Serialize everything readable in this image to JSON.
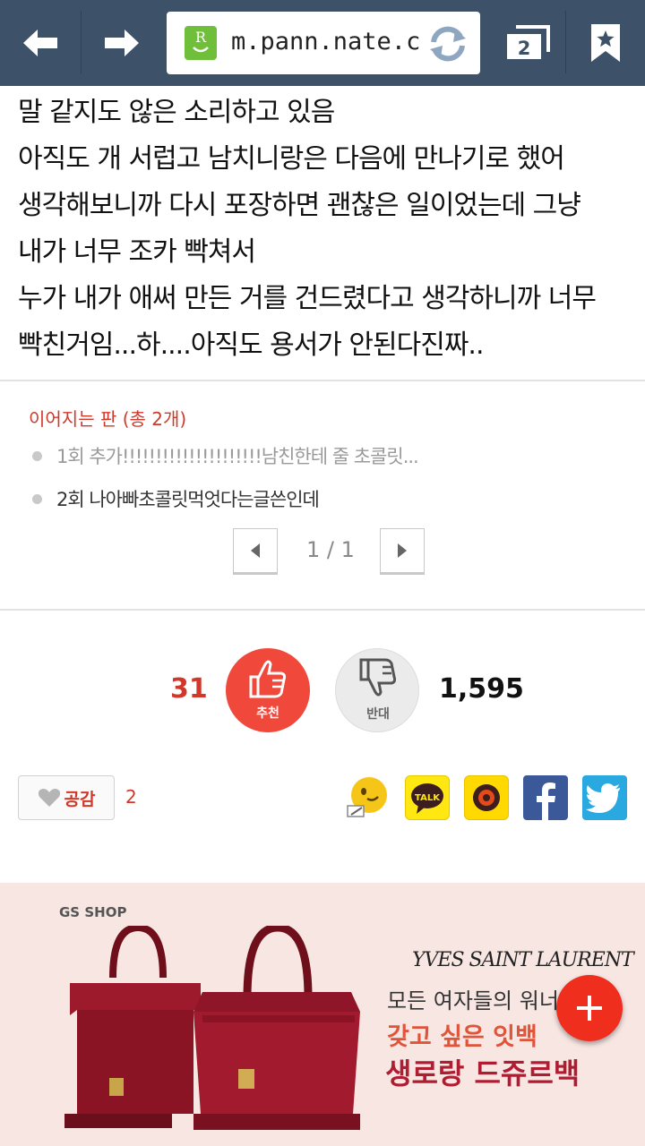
{
  "browser": {
    "url": "m.pann.nate.com",
    "logo_letter": "R",
    "tab_count": "2",
    "icons": [
      "back-arrow-icon",
      "forward-arrow-icon",
      "reload-icon",
      "tabs-icon",
      "bookmark-star-icon"
    ]
  },
  "article": {
    "lines": [
      "말 같지도 않은 소리하고 있음",
      "아직도 개 서럽고 남치니랑은 다음에 만나기로 했어",
      "생각해보니까 다시 포장하면 괜찮은 일이었는데 그냥",
      "내가 너무 조카 빡쳐서",
      "누가 내가 애써 만든 거를 건드렸다고 생각하니까 너무",
      "빡친거임...하....아직도 용서가 안된다진짜.."
    ]
  },
  "series": {
    "title": "이어지는 판 (총 2개)",
    "items": [
      "1회 추가!!!!!!!!!!!!!!!!!!!!!남친한테 줄 초콜릿...",
      "2회 나아빠초콜릿먹엇다는글쓴인데"
    ],
    "page_indicator": "1 / 1"
  },
  "vote": {
    "up_count": "31",
    "up_label": "추천",
    "down_label": "반대",
    "down_count": "1,595"
  },
  "empathy": {
    "label": "공감",
    "count": "2"
  },
  "share": [
    "comment-icon",
    "kakaotalk-icon",
    "kakaostory-icon",
    "facebook-icon",
    "twitter-icon"
  ],
  "ad": {
    "shop": "GS SHOP",
    "brand": "YVES SAINT LAURENT",
    "line1": "모든 여자들의 워너비",
    "line2": "갖고 싶은 잇백",
    "line3": "생로랑 드쥬르백"
  },
  "colors": {
    "toolbar": "#3d5269",
    "accent_red": "#d0392a",
    "like_red": "#f0483a",
    "fab_red": "#ef2e1e",
    "ad_bg": "#f8e6e3"
  }
}
